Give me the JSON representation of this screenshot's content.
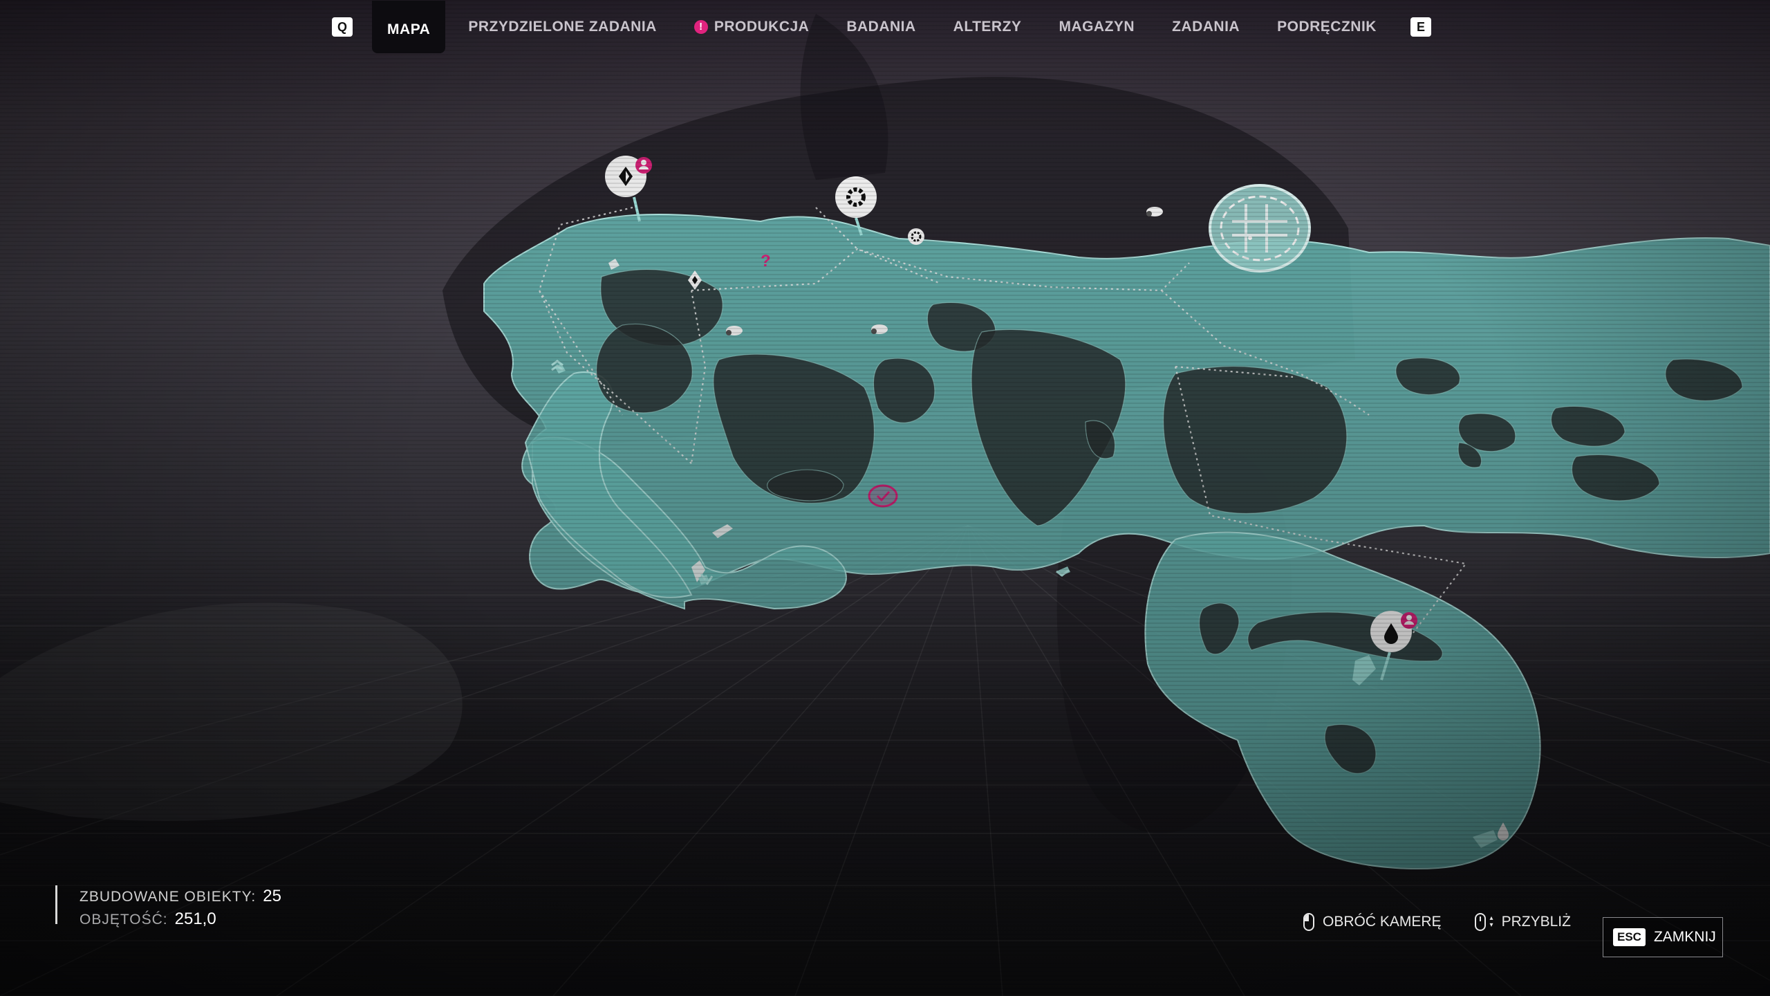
{
  "nav": {
    "left_key": "Q",
    "right_key": "E",
    "tabs": [
      {
        "label": "MAPA",
        "active": true,
        "alert": false
      },
      {
        "label": "PRZYDZIELONE ZADANIA",
        "active": false,
        "alert": false
      },
      {
        "label": "PRODUKCJA",
        "active": false,
        "alert": true
      },
      {
        "label": "BADANIA",
        "active": false,
        "alert": false
      },
      {
        "label": "ALTERZY",
        "active": false,
        "alert": false
      },
      {
        "label": "MAGAZYN",
        "active": false,
        "alert": false
      },
      {
        "label": "ZADANIA",
        "active": false,
        "alert": false
      },
      {
        "label": "PODRĘCZNIK",
        "active": false,
        "alert": false
      }
    ],
    "alert_glyph": "!"
  },
  "stats": {
    "built_label": "ZBUDOWANE OBIEKTY:",
    "built_value": "25",
    "volume_label": "OBJĘTOŚĆ:",
    "volume_value": "251,0"
  },
  "controls": {
    "rotate_label": "OBRÓĆ KAMERĘ",
    "zoom_label": "PRZYBLIŻ",
    "close_key": "ESC",
    "close_label": "ZAMKNIJ"
  },
  "map": {
    "icons": [
      "mineral-node-icon",
      "gear-node-icon",
      "water-node-icon",
      "outpost-icon",
      "question-marker-icon",
      "task-check-icon"
    ]
  },
  "colors": {
    "island": "#6ec4bf",
    "island_edge": "#b8f1ec",
    "accent_pink": "#e0237e",
    "tab_active_bg": "#0d0c10"
  }
}
